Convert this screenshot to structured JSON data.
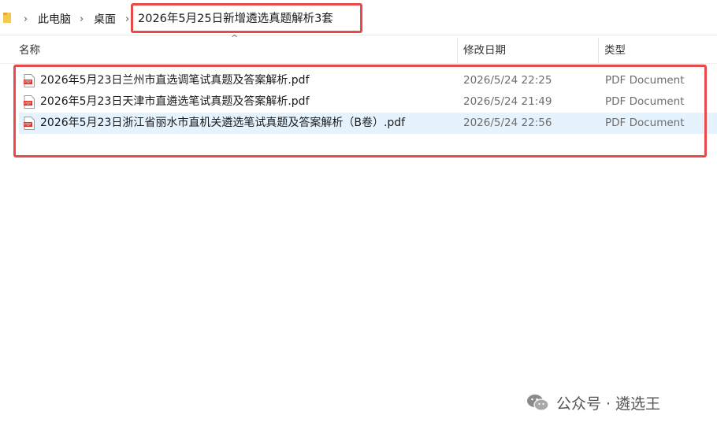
{
  "breadcrumb": {
    "items": [
      "此电脑",
      "桌面"
    ],
    "current": "2026年5月25日新增遴选真题解析3套"
  },
  "columns": {
    "name": "名称",
    "modified": "修改日期",
    "type": "类型"
  },
  "files": [
    {
      "name": "2026年5月23日兰州市直选调笔试真题及答案解析.pdf",
      "modified": "2026/5/24 22:25",
      "type": "PDF Document",
      "selected": false
    },
    {
      "name": "2026年5月23日天津市直遴选笔试真题及答案解析.pdf",
      "modified": "2026/5/24 21:49",
      "type": "PDF Document",
      "selected": false
    },
    {
      "name": "2026年5月23日浙江省丽水市直机关遴选笔试真题及答案解析（B卷）.pdf",
      "modified": "2026/5/24 22:56",
      "type": "PDF Document",
      "selected": true
    }
  ],
  "watermark": {
    "text": "公众号 · 遴选王",
    "icon": "wechat-icon"
  },
  "colors": {
    "highlight": "#e84a4a",
    "selection": "#e5f3ff",
    "pdf_red": "#d9342b"
  }
}
